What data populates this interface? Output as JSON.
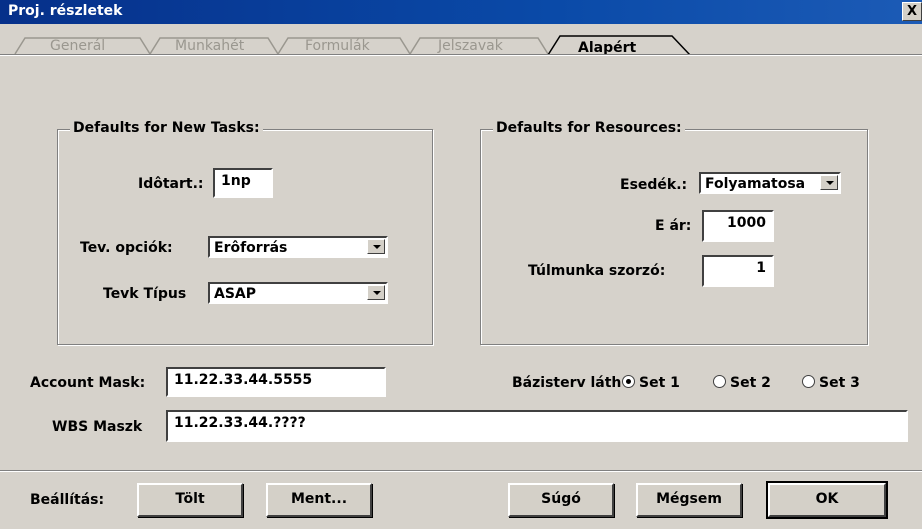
{
  "window": {
    "title": "Proj. részletek",
    "close_glyph": "X"
  },
  "tabs": [
    {
      "label": "Generál",
      "active": false
    },
    {
      "label": "Munkahét",
      "active": false
    },
    {
      "label": "Formulák",
      "active": false
    },
    {
      "label": "Jelszavak",
      "active": false
    },
    {
      "label": "Alapért",
      "active": true
    }
  ],
  "tasks_group": {
    "title": "Defaults for New Tasks:",
    "duration_label": "Idôtart.:",
    "duration_value": "1np",
    "options_label": "Tev. opciók:",
    "options_value": "Erôforrás",
    "type_label": "Tevk Típus",
    "type_value": "ASAP"
  },
  "resources_group": {
    "title": "Defaults for Resources:",
    "due_label": "Esedék.:",
    "due_value": "Folyamatosa",
    "price_label": "E ár:",
    "price_value": "1000",
    "overtime_label": "Túlmunka szorzó:",
    "overtime_value": "1"
  },
  "account_mask": {
    "label": "Account Mask:",
    "value": "11.22.33.44.5555"
  },
  "baseline": {
    "label": "Bázisterv láth",
    "options": [
      "Set 1",
      "Set 2",
      "Set 3"
    ],
    "selected_index": 0
  },
  "wbs_mask": {
    "label": "WBS Maszk",
    "value": "11.22.33.44.????"
  },
  "footer": {
    "settings_label": "Beállítás:",
    "load_label": "Tölt",
    "save_label": "Ment...",
    "help_label": "Súgó",
    "cancel_label": "Mégsem",
    "ok_label": "OK"
  }
}
